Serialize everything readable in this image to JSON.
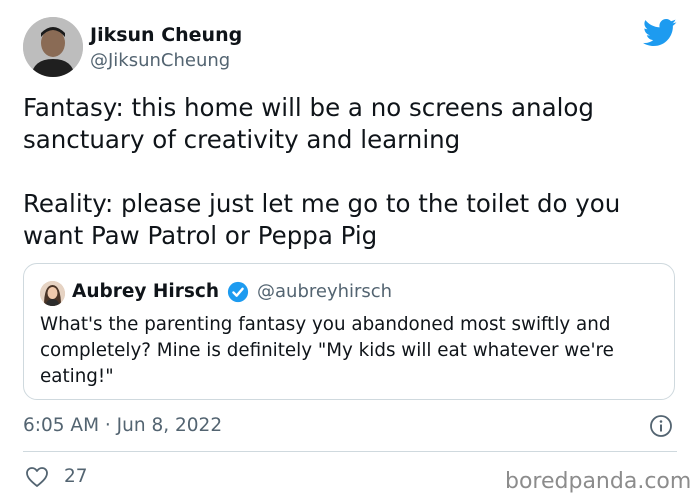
{
  "author": {
    "name": "Jiksun Cheung",
    "handle": "@JiksunCheung"
  },
  "tweet": {
    "text": "Fantasy: this home will be a no screens analog\nsanctuary of creativity and learning\n\nReality: please just let me go to the toilet do you\nwant Paw Patrol or Peppa Pig",
    "timestamp": "6:05 AM · Jun 8, 2022",
    "likes": "27"
  },
  "quoted": {
    "name": "Aubrey Hirsch",
    "handle": "@aubreyhirsch",
    "text": "What's the parenting fantasy you abandoned most swiftly and completely? Mine is definitely \"My kids will eat whatever we're eating!\""
  },
  "watermark": "boredpanda.com",
  "colors": {
    "twitter_blue": "#1d9bf0",
    "secondary_text": "#536471",
    "border": "#cfd9de"
  },
  "icons": {
    "brand": "twitter-bird-icon",
    "verified": "verified-badge-icon",
    "info": "info-icon",
    "like": "heart-icon"
  }
}
